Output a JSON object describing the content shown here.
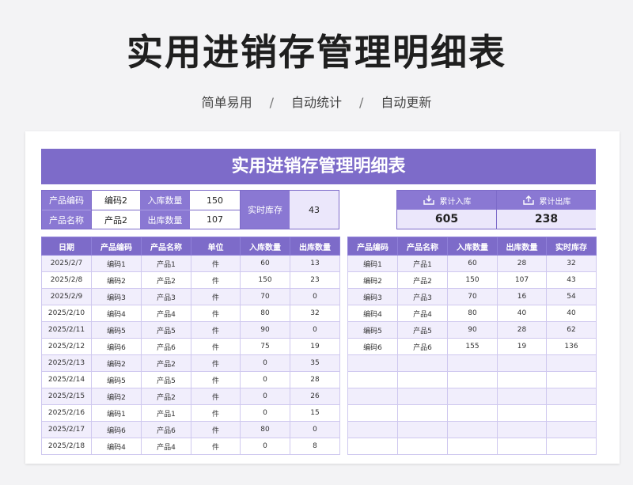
{
  "page": {
    "title": "实用进销存管理明细表",
    "subtitle_parts": [
      "简单易用",
      "自动统计",
      "自动更新"
    ],
    "separator": "/"
  },
  "sheet": {
    "banner": "实用进销存管理明细表",
    "info": {
      "code_label": "产品编码",
      "code_value": "编码2",
      "name_label": "产品名称",
      "name_value": "产品2",
      "in_label": "入库数量",
      "in_value": "150",
      "out_label": "出库数量",
      "out_value": "107",
      "stock_label": "实时库存",
      "stock_value": "43"
    },
    "summary": {
      "in_label": "累计入库",
      "in_value": "605",
      "out_label": "累计出库",
      "out_value": "238",
      "in_icon": "tray-in-icon",
      "out_icon": "tray-out-icon"
    },
    "left_table": {
      "headers": [
        "日期",
        "产品编码",
        "产品名称",
        "单位",
        "入库数量",
        "出库数量"
      ],
      "rows": [
        [
          "2025/2/7",
          "编码1",
          "产品1",
          "件",
          "60",
          "13"
        ],
        [
          "2025/2/8",
          "编码2",
          "产品2",
          "件",
          "150",
          "23"
        ],
        [
          "2025/2/9",
          "编码3",
          "产品3",
          "件",
          "70",
          "0"
        ],
        [
          "2025/2/10",
          "编码4",
          "产品4",
          "件",
          "80",
          "32"
        ],
        [
          "2025/2/11",
          "编码5",
          "产品5",
          "件",
          "90",
          "0"
        ],
        [
          "2025/2/12",
          "编码6",
          "产品6",
          "件",
          "75",
          "19"
        ],
        [
          "2025/2/13",
          "编码2",
          "产品2",
          "件",
          "0",
          "35"
        ],
        [
          "2025/2/14",
          "编码5",
          "产品5",
          "件",
          "0",
          "28"
        ],
        [
          "2025/2/15",
          "编码2",
          "产品2",
          "件",
          "0",
          "26"
        ],
        [
          "2025/2/16",
          "编码1",
          "产品1",
          "件",
          "0",
          "15"
        ],
        [
          "2025/2/17",
          "编码6",
          "产品6",
          "件",
          "80",
          "0"
        ],
        [
          "2025/2/18",
          "编码4",
          "产品4",
          "件",
          "0",
          "8"
        ]
      ]
    },
    "right_table": {
      "headers": [
        "产品编码",
        "产品名称",
        "入库数量",
        "出库数量",
        "实时库存"
      ],
      "rows": [
        [
          "编码1",
          "产品1",
          "60",
          "28",
          "32"
        ],
        [
          "编码2",
          "产品2",
          "150",
          "107",
          "43"
        ],
        [
          "编码3",
          "产品3",
          "70",
          "16",
          "54"
        ],
        [
          "编码4",
          "产品4",
          "80",
          "40",
          "40"
        ],
        [
          "编码5",
          "产品5",
          "90",
          "28",
          "62"
        ],
        [
          "编码6",
          "产品6",
          "155",
          "19",
          "136"
        ]
      ],
      "empty_rows": 6
    }
  },
  "colors": {
    "header_purple": "#7d6bc9",
    "label_purple": "#8a78d3",
    "alt_row": "#f1eefc",
    "highlight": "#ebe7fb"
  }
}
